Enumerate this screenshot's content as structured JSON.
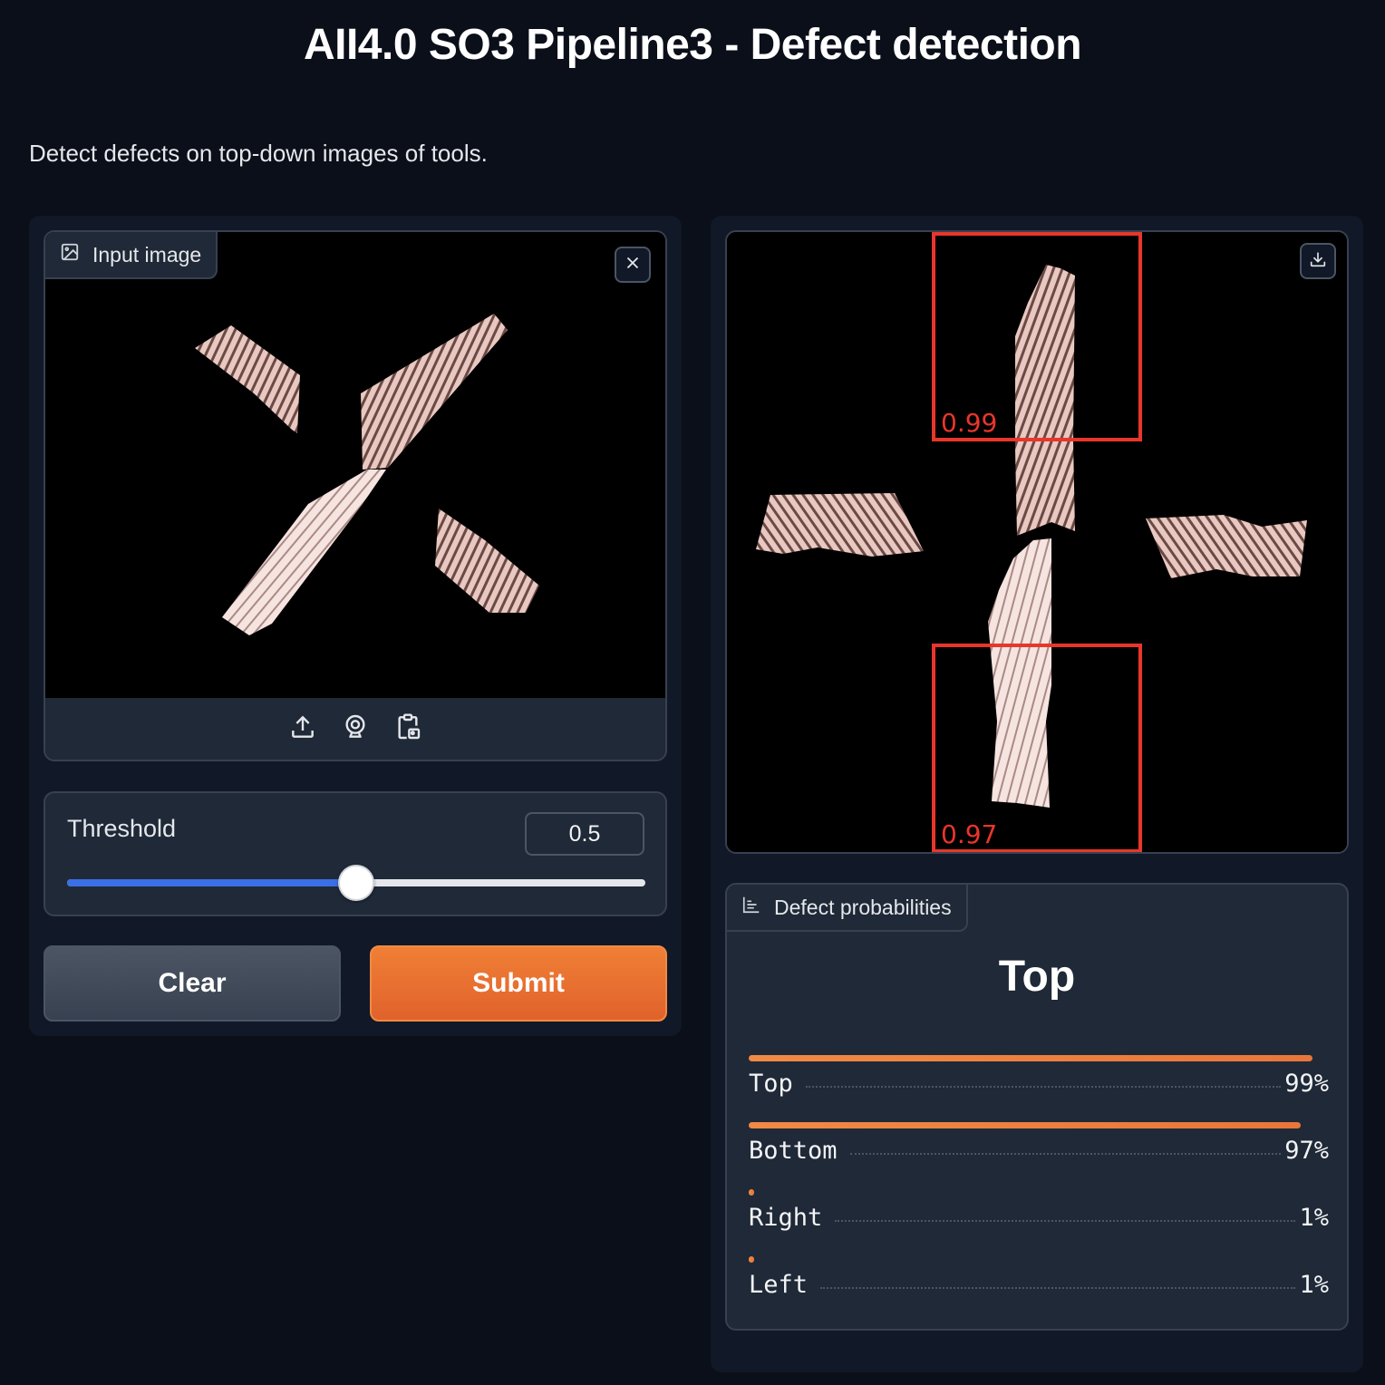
{
  "page": {
    "title": "AII4.0 SO3 Pipeline3 - Defect detection",
    "description": "Detect defects on top-down images of tools."
  },
  "input_image": {
    "label": "Input image",
    "icon": "image-icon",
    "source_icons": [
      "upload-icon",
      "webcam-icon",
      "clipboard-icon"
    ]
  },
  "threshold": {
    "label": "Threshold",
    "value": "0.5",
    "value_fraction": 0.5
  },
  "buttons": {
    "clear": "Clear",
    "submit": "Submit"
  },
  "output_image": {
    "detections": [
      {
        "score": "0.99"
      },
      {
        "score": "0.97"
      }
    ],
    "box_color": "#e8362a"
  },
  "defect_probabilities": {
    "label": "Defect probabilities",
    "icon": "bar-chart-icon",
    "top_label": "Top",
    "items": [
      {
        "name": "Top",
        "pct": "99%",
        "value": 0.99
      },
      {
        "name": "Bottom",
        "pct": "97%",
        "value": 0.97
      },
      {
        "name": "Right",
        "pct": "1%",
        "value": 0.01
      },
      {
        "name": "Left",
        "pct": "1%",
        "value": 0.01
      }
    ]
  },
  "colors": {
    "background": "#0b0f19",
    "panel": "#1f2937",
    "accent_orange": "#e8763a",
    "slider_blue": "#3b6fe8"
  }
}
